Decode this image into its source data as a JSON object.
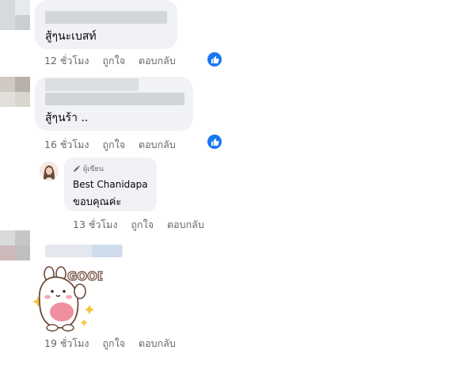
{
  "comments": [
    {
      "text": "สู้ๆนะเบสท์",
      "time": "12 ชั่วโมง",
      "like_label": "ถูกใจ",
      "reply_label": "ตอบกลับ"
    },
    {
      "text": "สู้ๆนร้า ..",
      "time": "16 ชั่วโมง",
      "like_label": "ถูกใจ",
      "reply_label": "ตอบกลับ"
    },
    {
      "text": "",
      "time": "19 ชั่วโมง",
      "like_label": "ถูกใจ",
      "reply_label": "ตอบกลับ",
      "sticker": {
        "caption": "GOOD"
      }
    }
  ],
  "reply": {
    "badge": "ผู้เขียน",
    "author": "Best Chanidapa",
    "text": "ขอบคุณค่ะ",
    "time": "13 ชั่วโมง",
    "like_label": "ถูกใจ",
    "reply_label": "ตอบกลับ"
  },
  "colors": {
    "bubble": "#f0f2f5",
    "meta_text": "#65676b",
    "like_blue": "#1877f2"
  }
}
